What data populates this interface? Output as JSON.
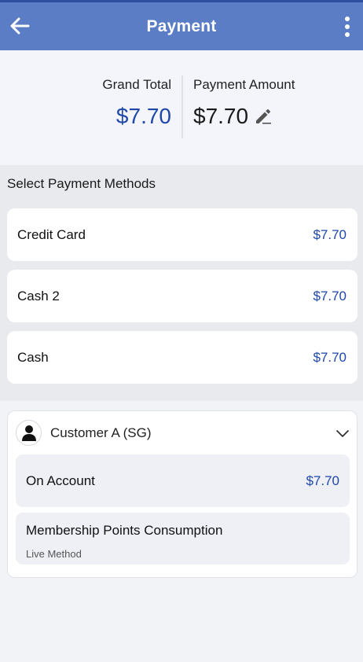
{
  "appbar": {
    "title": "Payment",
    "back_icon": "arrow-left-icon",
    "more_icon": "more-vertical-icon",
    "color": "#5a7dc6"
  },
  "summary": {
    "grand_total_label": "Grand Total",
    "grand_total_value": "$7.70",
    "payment_amount_label": "Payment Amount",
    "payment_amount_value": "$7.70",
    "edit_icon": "pencil-icon"
  },
  "methods": {
    "heading": "Select Payment Methods",
    "items": [
      {
        "name": "Credit Card",
        "amount": "$7.70"
      },
      {
        "name": "Cash 2",
        "amount": "$7.70"
      },
      {
        "name": "Cash",
        "amount": "$7.70"
      }
    ]
  },
  "customer": {
    "name": "Customer A (SG)",
    "avatar_icon": "user-icon",
    "chevron_icon": "chevron-down-icon",
    "on_account": {
      "name": "On Account",
      "amount": "$7.70"
    },
    "membership": {
      "name": "Membership Points Consumption",
      "subtitle": "Live Method"
    }
  },
  "colors": {
    "accent": "#1e47a8",
    "background": "#f2f3f7"
  }
}
